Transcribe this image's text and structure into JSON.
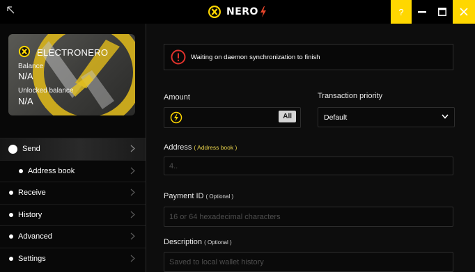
{
  "app": {
    "name": "NERO"
  },
  "titlebar": {
    "help_label": "?"
  },
  "wallet": {
    "name": "ELECTRONERO",
    "balance_label": "Balance",
    "balance_value": "N/A",
    "unlocked_label": "Unlocked balance",
    "unlocked_value": "N/A"
  },
  "menu": [
    {
      "label": "Send"
    },
    {
      "label": "Address book"
    },
    {
      "label": "Receive"
    },
    {
      "label": "History"
    },
    {
      "label": "Advanced"
    },
    {
      "label": "Settings"
    }
  ],
  "warning": {
    "text": "Waiting on daemon synchronization to finish"
  },
  "form": {
    "amount_label": "Amount",
    "all_button": "All",
    "priority_label": "Transaction priority",
    "priority_value": "Default",
    "address_label": "Address",
    "address_book_link": "( Address book )",
    "address_placeholder": "4..",
    "payment_label": "Payment ID",
    "payment_optional": "( Optional )",
    "payment_placeholder": "16 or 64 hexadecimal characters",
    "description_label": "Description",
    "description_optional": "( Optional )",
    "description_placeholder": "Saved to local wallet history"
  },
  "colors": {
    "accent": "#ffd700",
    "background": "#0d0d0d",
    "warning": "#e0322c"
  }
}
